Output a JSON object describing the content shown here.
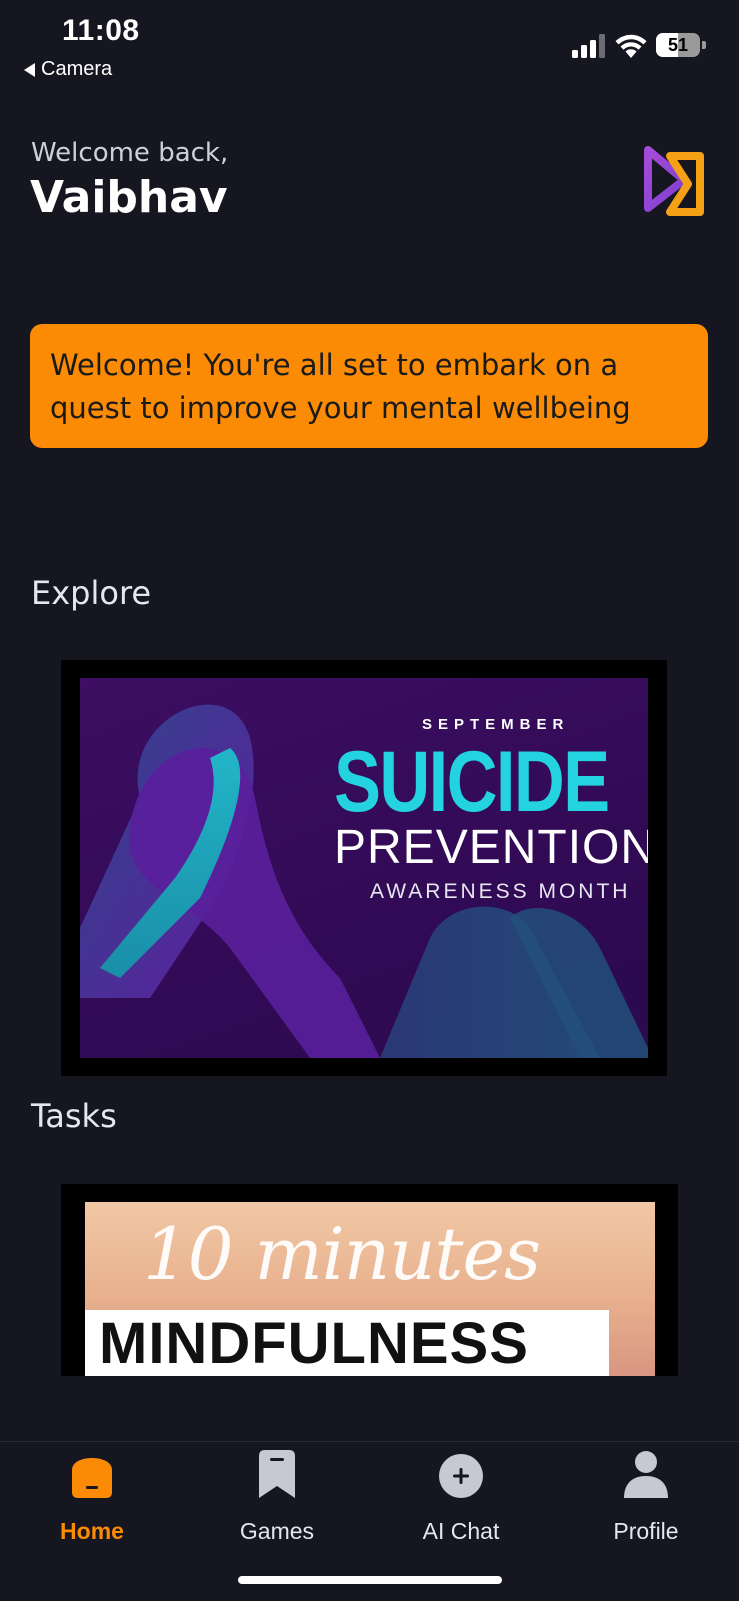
{
  "status": {
    "time": "11:08",
    "back_app": "Camera",
    "battery": "51",
    "battery_level": 0.51
  },
  "header": {
    "greeting": "Welcome back,",
    "username": "Vaibhav",
    "logo_icon": "brand-logo-icon"
  },
  "banner": {
    "text": "Welcome! You're all set to embark on a quest to improve your mental wellbeing",
    "color": "#fb8b05"
  },
  "explore": {
    "title": "Explore",
    "card": {
      "month": "SEPTEMBER",
      "headline": "SUICIDE",
      "subhead": "PREVENTION",
      "tagline": "AWARENESS MONTH"
    }
  },
  "tasks": {
    "title": "Tasks",
    "card": {
      "line1": "10 minutes",
      "line2": "MINDFULNESS"
    }
  },
  "tabs": [
    {
      "label": "Home",
      "icon": "home-icon",
      "active": true
    },
    {
      "label": "Games",
      "icon": "bookmark-icon",
      "active": false
    },
    {
      "label": "AI Chat",
      "icon": "plus-circle-icon",
      "active": false
    },
    {
      "label": "Profile",
      "icon": "person-icon",
      "active": false
    }
  ],
  "colors": {
    "background": "#161621",
    "accent": "#fb8b05",
    "inactive_icon": "#c8c8d4"
  }
}
